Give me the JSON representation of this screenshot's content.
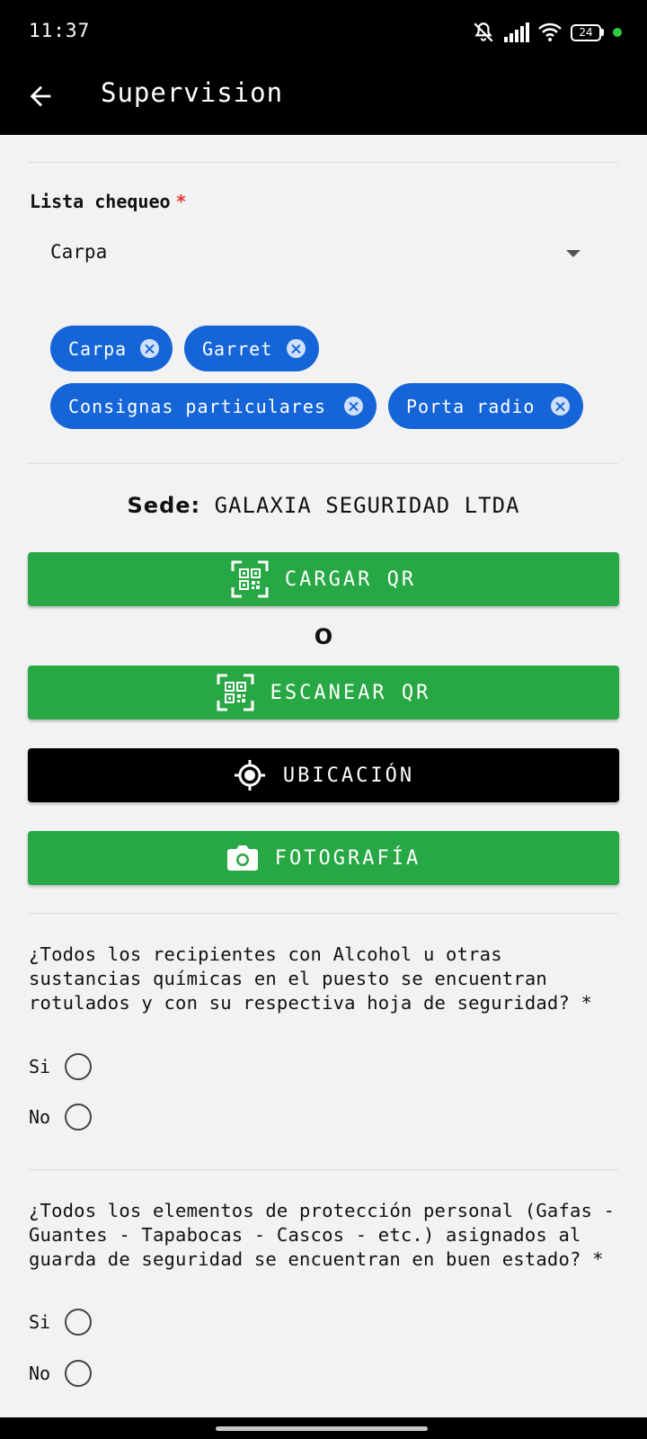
{
  "status_bar": {
    "time": "11:37",
    "battery": "24",
    "icons": [
      "mute-icon",
      "signal-icon",
      "wifi-icon",
      "battery-icon",
      "notification-dot"
    ]
  },
  "app_bar": {
    "title": "Supervision",
    "back_icon": "arrow-back-icon"
  },
  "checklist": {
    "label": "Lista chequeo",
    "required_mark": "*",
    "selected_value": "Carpa",
    "chips": [
      "Carpa",
      "Garret",
      "Consignas particulares",
      "Porta radio"
    ]
  },
  "sede": {
    "label": "Sede:",
    "value": "GALAXIA SEGURIDAD LTDA"
  },
  "buttons": {
    "cargar_qr": "CARGAR QR",
    "or_text": "O",
    "escanear_qr": "ESCANEAR QR",
    "ubicacion": "UBICACIÓN",
    "fotografia": "FOTOGRAFÍA"
  },
  "colors": {
    "green": "#28a745",
    "chip_blue": "#1565d8",
    "required_red": "#e53935",
    "black": "#000000"
  },
  "questions": [
    {
      "text": "¿Todos los recipientes con Alcohol u otras sustancias químicas en el puesto se encuentran rotulados y con su respectiva hoja de seguridad? *",
      "options": [
        "Si",
        "No"
      ]
    },
    {
      "text": "¿Todos los elementos de protección personal (Gafas - Guantes - Tapabocas - Cascos - etc.) asignados al guarda de seguridad se encuentran en buen estado? *",
      "options": [
        "Si",
        "No"
      ]
    }
  ]
}
